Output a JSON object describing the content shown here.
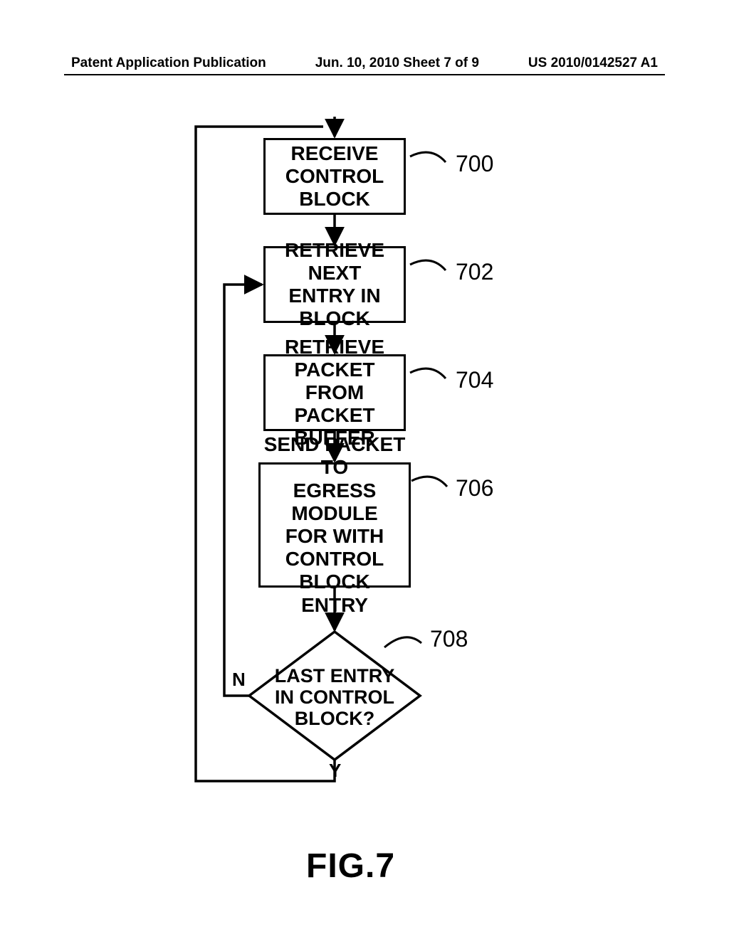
{
  "header": {
    "left": "Patent Application Publication",
    "center": "Jun. 10, 2010  Sheet 7 of 9",
    "right": "US 2010/0142527 A1"
  },
  "steps": {
    "s700": {
      "text": "RECEIVE\nCONTROL\nBLOCK",
      "ref": "700"
    },
    "s702": {
      "text": "RETRIEVE NEXT\nENTRY IN\nBLOCK",
      "ref": "702"
    },
    "s704": {
      "text": "RETRIEVE\nPACKET FROM\nPACKET BUFFER",
      "ref": "704"
    },
    "s706": {
      "text": "SEND PACKET TO\nEGRESS MODULE\nFOR WITH\nCONTROL BLOCK\nENTRY",
      "ref": "706"
    },
    "s708": {
      "text": "LAST ENTRY\nIN CONTROL\nBLOCK?",
      "ref": "708"
    }
  },
  "branches": {
    "no": "N",
    "yes": "Y"
  },
  "figure": "FIG.7"
}
